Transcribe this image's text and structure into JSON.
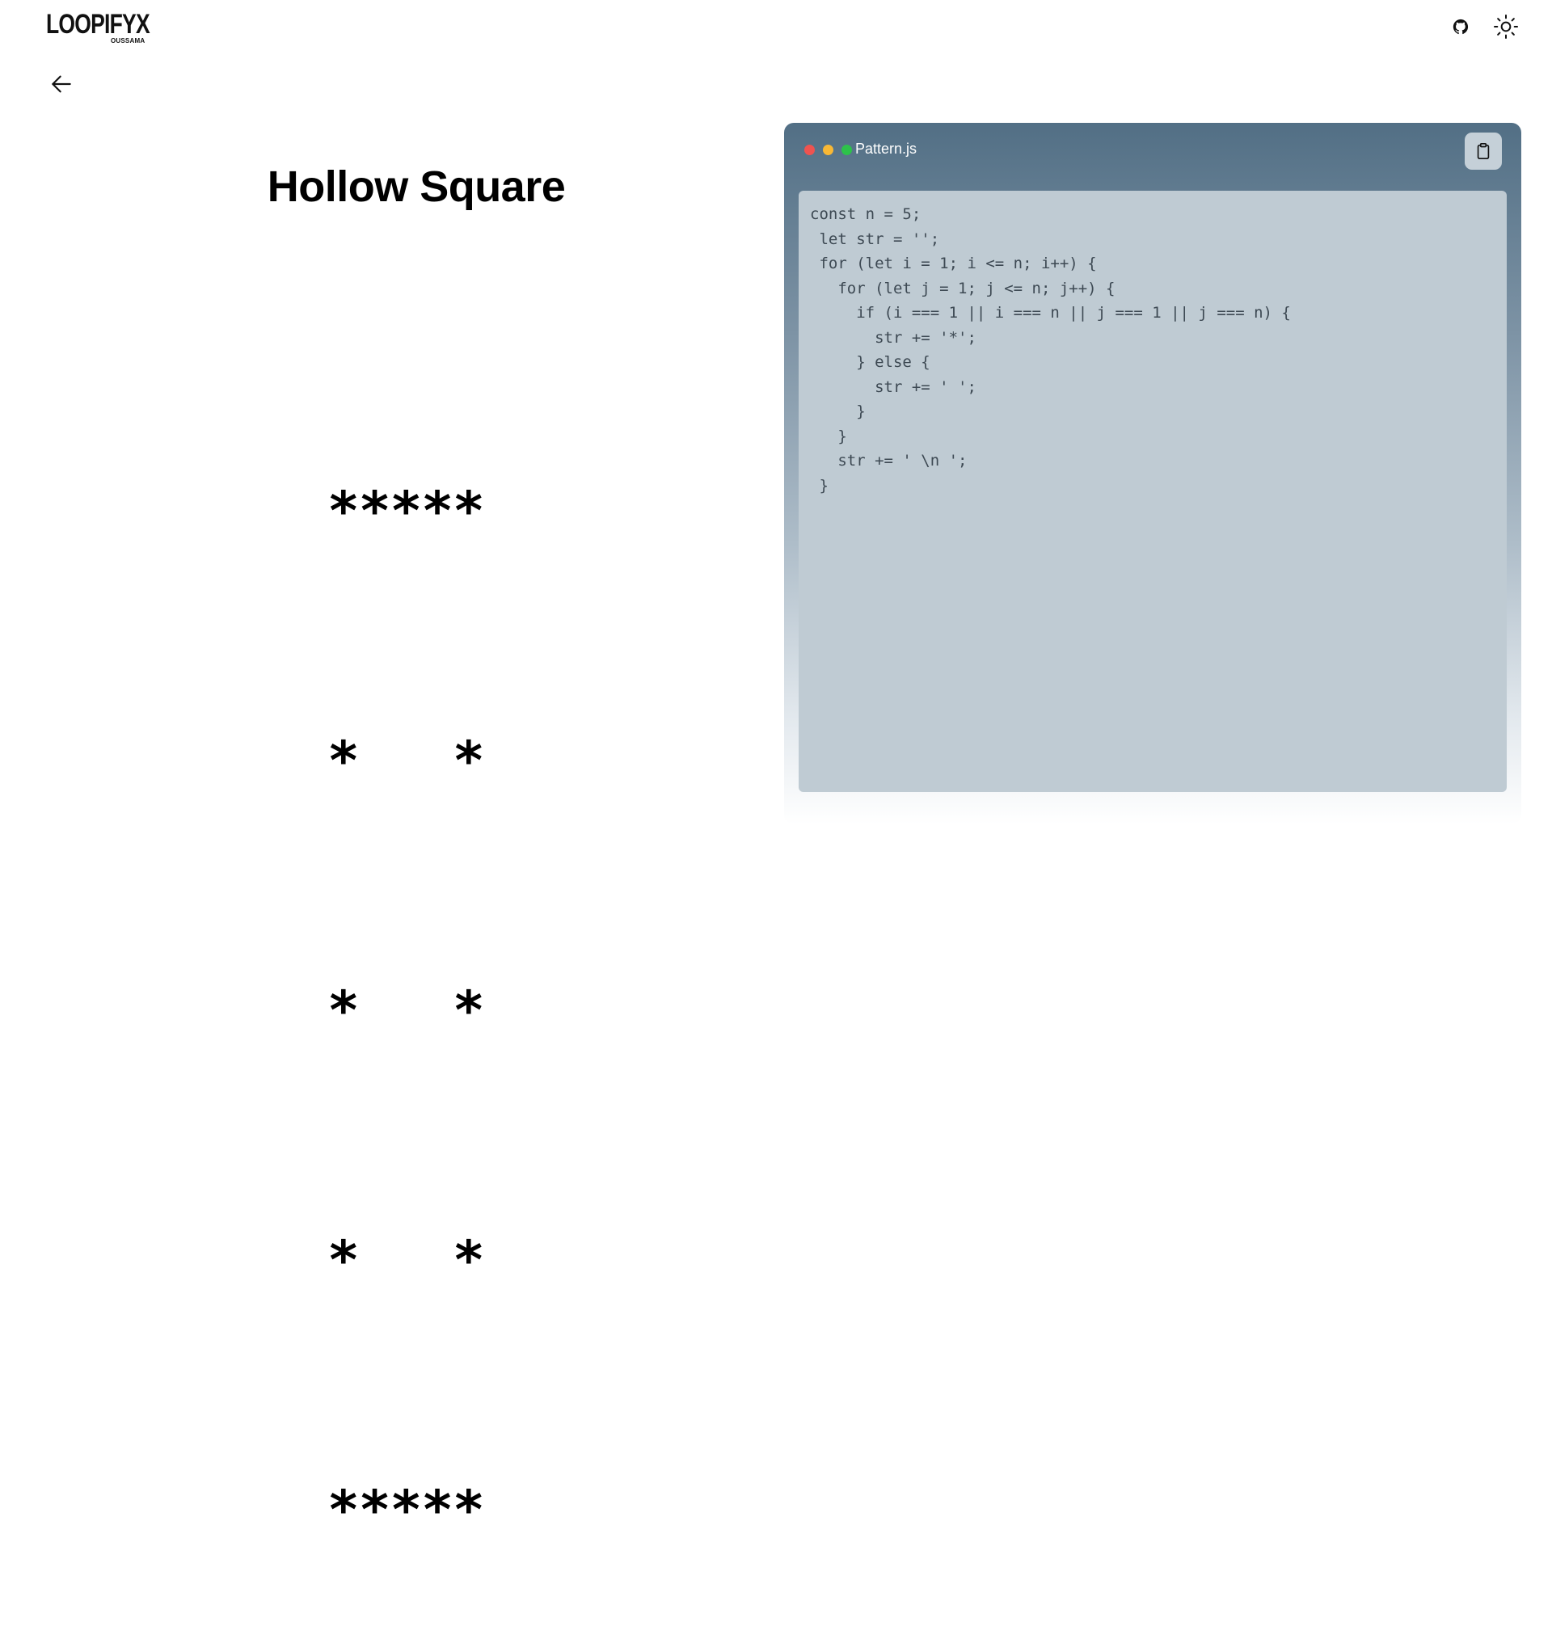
{
  "header": {
    "logo_text": "LOOPIFYX",
    "logo_subtext": "OUSSAMA",
    "github_icon": "github-icon",
    "theme_icon": "sun-icon"
  },
  "nav": {
    "back_icon": "arrow-left-icon"
  },
  "pattern": {
    "title": "Hollow Square",
    "rows": [
      "*****",
      "*   *",
      "*   *",
      "*   *",
      "*****"
    ]
  },
  "editor": {
    "filename": "Pattern.js",
    "copy_icon": "clipboard-icon",
    "code_lines": [
      "const n = 5;",
      " let str = '';",
      " for (let i = 1; i <= n; i++) {",
      "   for (let j = 1; j <= n; j++) {",
      "     if (i === 1 || i === n || j === 1 || j === n) {",
      "       str += '*';",
      "     } else {",
      "       str += ' ';",
      "     }",
      "   }",
      "   str += ' \\n ';",
      " }"
    ],
    "colors": {
      "dot_red": "#ef5350",
      "dot_yellow": "#f9b835",
      "dot_green": "#2dc24a",
      "header_bg": "#526f85",
      "code_bg": "#bfcbd3"
    }
  }
}
